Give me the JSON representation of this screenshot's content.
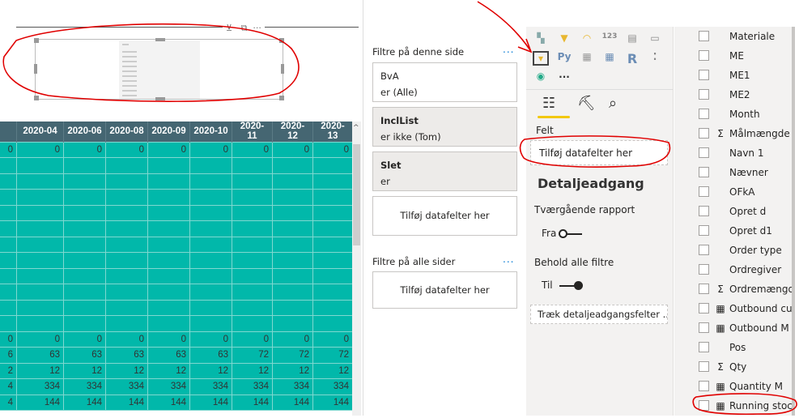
{
  "canvas": {
    "visual_header_icons": [
      "filter-icon",
      "focus-mode-icon",
      "more-options-icon"
    ],
    "table": {
      "columns": [
        "",
        "2020-04",
        "2020-06",
        "2020-08",
        "2020-09",
        "2020-10",
        "2020-11",
        "2020-12",
        "2020-13"
      ],
      "rows": [
        [
          "0",
          "0",
          "0",
          "0",
          "0",
          "0",
          "0",
          "0",
          "0"
        ],
        [
          "",
          "",
          "",
          "",
          "",
          "",
          "",
          "",
          ""
        ],
        [
          "",
          "",
          "",
          "",
          "",
          "",
          "",
          "",
          ""
        ],
        [
          "",
          "",
          "",
          "",
          "",
          "",
          "",
          "",
          ""
        ],
        [
          "",
          "",
          "",
          "",
          "",
          "",
          "",
          "",
          ""
        ],
        [
          "",
          "",
          "",
          "",
          "",
          "",
          "",
          "",
          ""
        ],
        [
          "",
          "",
          "",
          "",
          "",
          "",
          "",
          "",
          ""
        ],
        [
          "",
          "",
          "",
          "",
          "",
          "",
          "",
          "",
          ""
        ],
        [
          "",
          "",
          "",
          "",
          "",
          "",
          "",
          "",
          ""
        ],
        [
          "",
          "",
          "",
          "",
          "",
          "",
          "",
          "",
          ""
        ],
        [
          "",
          "",
          "",
          "",
          "",
          "",
          "",
          "",
          ""
        ],
        [
          "",
          "",
          "",
          "",
          "",
          "",
          "",
          "",
          ""
        ],
        [
          "0",
          "0",
          "0",
          "0",
          "0",
          "0",
          "0",
          "0",
          "0"
        ],
        [
          "6",
          "63",
          "63",
          "63",
          "63",
          "63",
          "72",
          "72",
          "72"
        ],
        [
          "2",
          "12",
          "12",
          "12",
          "12",
          "12",
          "12",
          "12",
          "12"
        ],
        [
          "4",
          "334",
          "334",
          "334",
          "334",
          "334",
          "334",
          "334",
          "334"
        ],
        [
          "4",
          "144",
          "144",
          "144",
          "144",
          "144",
          "144",
          "144",
          "144"
        ]
      ]
    },
    "colors": {
      "header": "#456672",
      "cell": "#01b8aa",
      "annotation": "#e00000"
    }
  },
  "filters": {
    "page_title": "Filtre på denne side",
    "more": "...",
    "cards": [
      {
        "name": "BvA",
        "value": "er (Alle)"
      },
      {
        "name": "InclList",
        "value": "er ikke (Tom)"
      },
      {
        "name": "Slet",
        "value": "er"
      }
    ],
    "add_page": "Tilføj datafelter her",
    "all_title": "Filtre på alle sider",
    "add_all": "Tilføj datafelter her"
  },
  "viz": {
    "more": "...",
    "py": "Py",
    "r": "R",
    "felt_label": "Felt",
    "felt_placeholder": "Tilføj datafelter her",
    "drill_title": "Detaljeadgang",
    "cross_report": "Tværgående rapport",
    "cross_state": "Fra",
    "keep_filters": "Behold alle filtre",
    "keep_state": "Til",
    "drill_placeholder": "Træk detaljeadgangsfelter ..."
  },
  "fields": [
    {
      "label": "Materiale",
      "icon": ""
    },
    {
      "label": "ME",
      "icon": ""
    },
    {
      "label": "ME1",
      "icon": ""
    },
    {
      "label": "ME2",
      "icon": ""
    },
    {
      "label": "Month",
      "icon": ""
    },
    {
      "label": "Målmængde",
      "icon": "Σ"
    },
    {
      "label": "Navn 1",
      "icon": ""
    },
    {
      "label": "Nævner",
      "icon": ""
    },
    {
      "label": "OFkA",
      "icon": ""
    },
    {
      "label": "Opret d",
      "icon": ""
    },
    {
      "label": "Opret d1",
      "icon": ""
    },
    {
      "label": "Order type",
      "icon": ""
    },
    {
      "label": "Ordregiver",
      "icon": ""
    },
    {
      "label": "Ordremængde",
      "icon": "Σ"
    },
    {
      "label": "Outbound cur",
      "icon": "▦"
    },
    {
      "label": "Outbound M",
      "icon": "▦"
    },
    {
      "label": "Pos",
      "icon": ""
    },
    {
      "label": "Qty",
      "icon": "Σ"
    },
    {
      "label": "Quantity M",
      "icon": "▦"
    },
    {
      "label": "Running stock",
      "icon": "▦"
    }
  ]
}
